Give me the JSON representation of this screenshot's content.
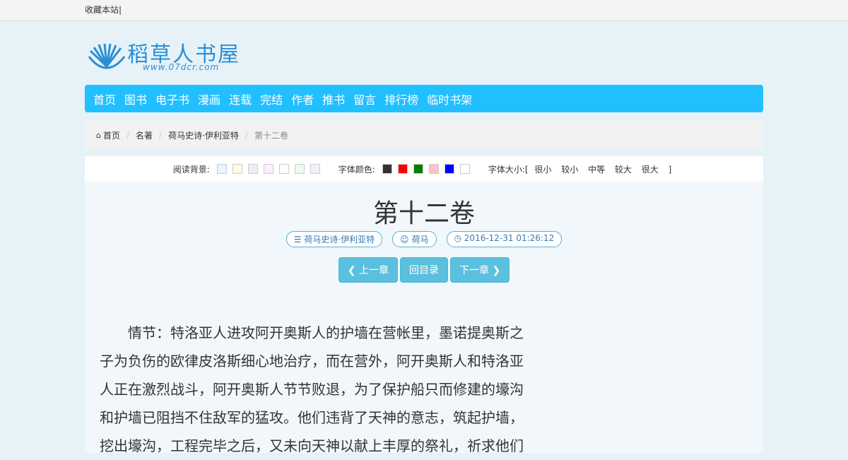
{
  "topbar": {
    "bookmark": "收藏本站|"
  },
  "logo": {
    "name": "稻草人书屋",
    "url": "www.07dcr.com"
  },
  "nav": [
    "首页",
    "图书",
    "电子书",
    "漫画",
    "连载",
    "完结",
    "作者",
    "推书",
    "留言",
    "排行榜",
    "临时书架"
  ],
  "breadcrumb": {
    "home": "首页",
    "category": "名著",
    "book": "荷马史诗·伊利亚特",
    "current": "第十二卷"
  },
  "settings": {
    "bg_label": "阅读背景:",
    "bg_colors": [
      "#e8f4ff",
      "#fdfde6",
      "#efefef",
      "#fbeefd",
      "#ffffff",
      "#eefaee",
      "#eef2f8"
    ],
    "font_color_label": "字体颜色:",
    "font_colors": [
      "#333333",
      "#ff0000",
      "#008000",
      "#ffc0cb",
      "#0000ff",
      "#ffffff"
    ],
    "size_label": "字体大小:[",
    "sizes": [
      "很小",
      "较小",
      "中等",
      "较大",
      "很大"
    ],
    "size_end": "]"
  },
  "chapter": {
    "title": "第十二卷",
    "book": "荷马史诗·伊利亚特",
    "author": "荷马",
    "datetime": "2016-12-31 01:26:12"
  },
  "buttons": {
    "prev": "上一章",
    "toc": "回目录",
    "next": "下一章"
  },
  "content": "情节：特洛亚人进攻阿开奥斯人的护墙在营帐里，墨诺提奥斯之子为负伤的欧律皮洛斯细心地治疗，而在营外，阿开奥斯人和特洛亚人正在激烈战斗，阿开奥斯人节节败退，为了保护船只而修建的壕沟和护墙已阻挡不住敌军的猛攻。他们违背了天神的意志，筑起护墙，挖出壕沟，工程完毕之后，又未向天神以献上丰厚的祭礼，祈求他们"
}
